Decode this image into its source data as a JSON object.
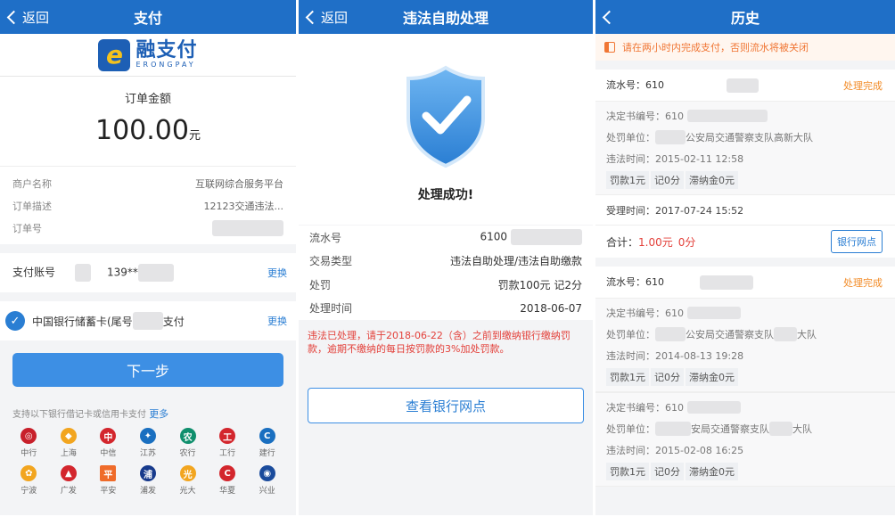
{
  "p1": {
    "back": "返回",
    "title": "支付",
    "logo": {
      "big": "融支付",
      "small": "ERONGPAY"
    },
    "amount_label": "订单金额",
    "amount": "100.00",
    "amount_unit": "元",
    "info": [
      {
        "k": "商户名称",
        "v": "互联网综合服务平台"
      },
      {
        "k": "订单描述",
        "v": "12123交通违法..."
      },
      {
        "k": "订单号",
        "v": ""
      }
    ],
    "account_label": "支付账号",
    "account_value": "139**",
    "change": "更换",
    "card": "中国银行储蓄卡(尾号",
    "card_tail": "支付",
    "next": "下一步",
    "support": "支持以下银行借记卡或信用卡支付",
    "more": "更多",
    "banks": [
      "中行",
      "上海",
      "中信",
      "江苏",
      "农行",
      "工行",
      "建行",
      "宁波",
      "广发",
      "平安",
      "浦发",
      "光大",
      "华夏",
      "兴业"
    ]
  },
  "p2": {
    "back": "返回",
    "title": "违法自助处理",
    "success": "处理成功!",
    "rows": [
      {
        "k": "流水号",
        "v": "6100"
      },
      {
        "k": "交易类型",
        "v": "违法自助处理/违法自助缴款"
      },
      {
        "k": "处罚",
        "v": "罚款100元  记2分"
      },
      {
        "k": "处理时间",
        "v": "2018-06-07"
      }
    ],
    "warning": "违法已处理，请于2018-06-22（含）之前到缴纳银行缴纳罚款，逾期不缴纳的每日按罚款的3%加处罚款。",
    "view": "查看银行网点"
  },
  "p3": {
    "title": "历史",
    "notice": "请在两小时内完成支付，否则流水将被关闭",
    "r1": {
      "serial": "流水号：610",
      "status": "处理完成",
      "decision": "决定书编号：610",
      "unit": "处罚单位：",
      "unit_tail": "公安局交通警察支队高新大队",
      "time": "违法时间：2015-02-11 12:58",
      "fine": "罚款1元",
      "points": "记0分",
      "late": "滞纳金0元",
      "accept": "受理时间：2017-07-24 15:52",
      "total_label": "合计：",
      "total_amount": "1.00元",
      "total_points": "0分",
      "bank_btn": "银行网点"
    },
    "r2": {
      "serial": "流水号：610",
      "status": "处理完成",
      "decision": "决定书编号：610",
      "unit": "处罚单位：",
      "unit_tail": "公安局交通警察支队",
      "unit_tail2": "大队",
      "time": "违法时间：2014-08-13 19:28",
      "fine": "罚款1元",
      "points": "记0分",
      "late": "滞纳金0元"
    },
    "r3": {
      "decision": "决定书编号：610",
      "unit": "处罚单位：",
      "unit_tail": "安局交通警察支队",
      "unit_tail2": "大队",
      "time": "违法时间：2015-02-08 16:25",
      "fine": "罚款1元",
      "points": "记0分",
      "late": "滞纳金0元"
    }
  },
  "colors": {
    "nav": "#1f6fc7",
    "button": "#3d8fe4",
    "warning": "#e3403a",
    "notice": "#f07634",
    "status": "#f28c28"
  }
}
